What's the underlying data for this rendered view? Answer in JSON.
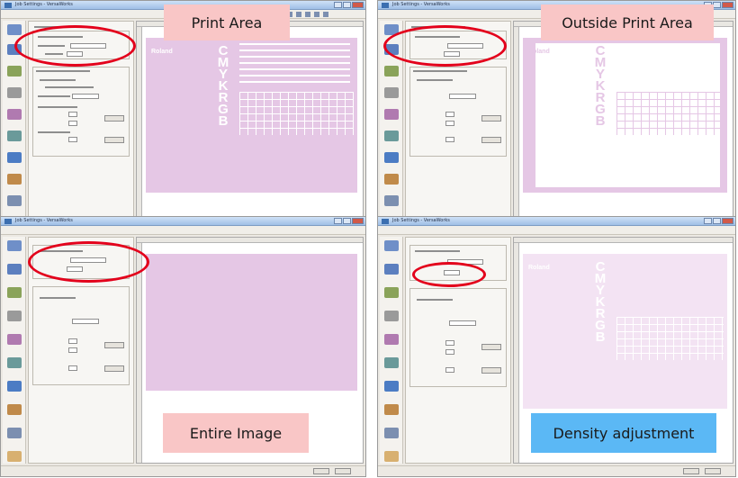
{
  "quadrants": [
    {
      "id": "tl",
      "callout": "Print Area",
      "callout_color": "#f9c6c6",
      "mode": "print-area"
    },
    {
      "id": "tr",
      "callout": "Outside Print Area",
      "callout_color": "#f9c6c6",
      "mode": "outside"
    },
    {
      "id": "bl",
      "callout": "Entire Image",
      "callout_color": "#f9c6c6",
      "mode": "entire"
    },
    {
      "id": "br",
      "callout": "Density adjustment",
      "callout_color": "#5bb8f5",
      "mode": "density"
    }
  ],
  "window": {
    "title_text": "Job Settings - VersaWorks"
  },
  "preview": {
    "logo_text": "Roland",
    "letters": [
      "C",
      "M",
      "Y",
      "K",
      "R",
      "G",
      "B"
    ]
  },
  "colors": {
    "highlight": "#e3001b",
    "print_fill": "#e5c7e5"
  }
}
